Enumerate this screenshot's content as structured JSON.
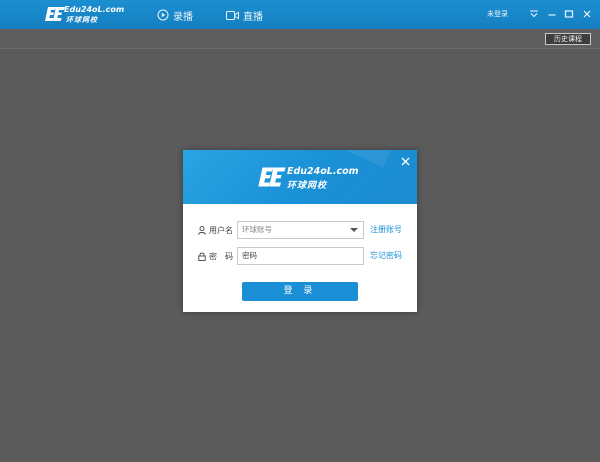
{
  "app": {
    "logo_en": "Edu24oL.com",
    "logo_cn": "环球网校"
  },
  "nav": {
    "recorded_label": "录播",
    "live_label": "直播"
  },
  "status": {
    "login_status": "未登录"
  },
  "toolbar": {
    "history_label": "历史课程"
  },
  "dialog": {
    "logo_en": "Edu24oL.com",
    "logo_cn": "环球网校",
    "username_label": "用户名",
    "username_placeholder": "环球账号",
    "password_label": "密　码",
    "password_placeholder": "密码",
    "register_link": "注册账号",
    "forgot_link": "忘记密码",
    "login_button": "登 录"
  },
  "colors": {
    "brand_blue": "#1a8fd6",
    "background": "#5b5b5b"
  },
  "icons": [
    "play-circle-icon",
    "video-camera-icon",
    "menu-down-icon",
    "minimize-icon",
    "maximize-icon",
    "close-icon",
    "user-icon",
    "lock-icon",
    "dropdown-arrow-icon"
  ]
}
